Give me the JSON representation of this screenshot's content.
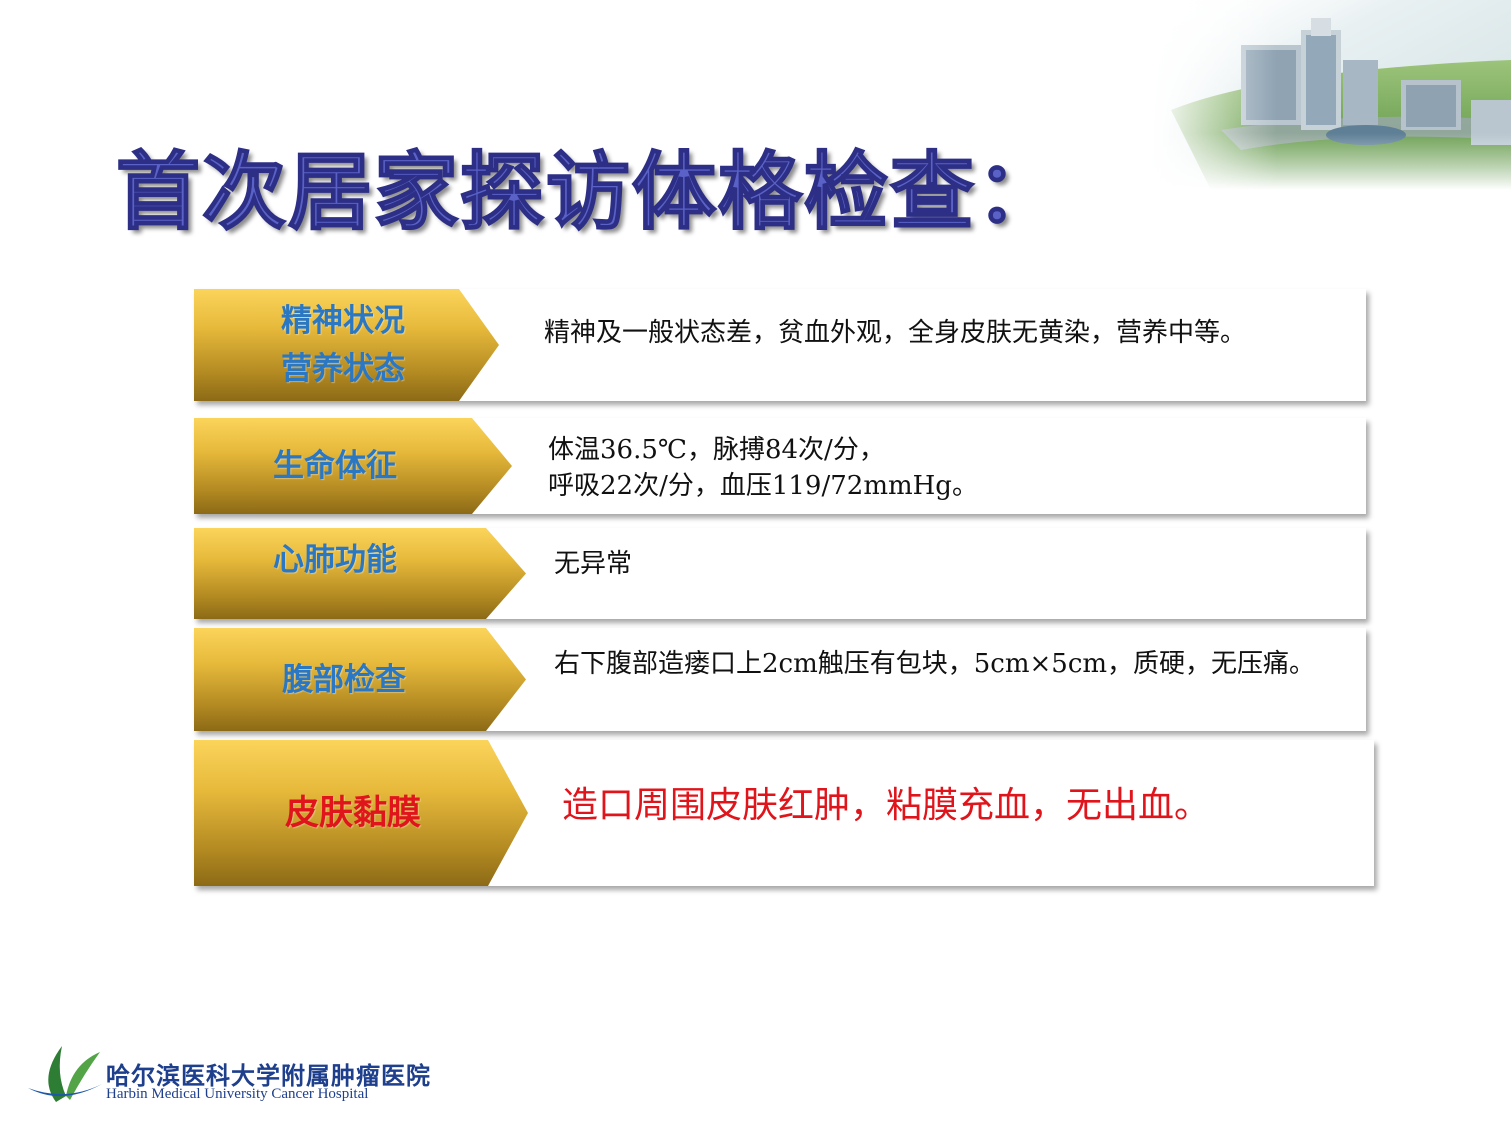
{
  "slide": {
    "title": "首次居家探访体格检查："
  },
  "rows": [
    {
      "label_lines": [
        "精神状况",
        "营养状态"
      ],
      "text_lines": [
        "精神及一般状态差，贫血外观，全身皮肤无黄染，营养中等。"
      ]
    },
    {
      "label_lines": [
        "生命体征"
      ],
      "text_lines": [
        "体温36.5℃，脉搏84次/分，",
        "呼吸22次/分，血压119/72mmHg。"
      ]
    },
    {
      "label_lines": [
        "心肺功能"
      ],
      "text_lines": [
        "无异常"
      ]
    },
    {
      "label_lines": [
        "腹部检查"
      ],
      "text_lines": [
        "右下腹部造瘘口上2cm触压有包块，5cm×5cm，质硬，无压痛。"
      ]
    },
    {
      "label_lines": [
        "皮肤黏膜"
      ],
      "text_lines": [
        "造口周围皮肤红肿，粘膜充血，无出血。"
      ]
    }
  ],
  "footer": {
    "hospital_name_cn": "哈尔滨医科大学附属肿瘤医院",
    "hospital_name_en": "Harbin Medical University Cancer Hospital"
  },
  "colors": {
    "title": "#5a62c8",
    "label": "#2a77c4",
    "highlight": "#e0141b",
    "tab_gold": "#e6b93b"
  },
  "icons": [
    "hospital-buildings-image",
    "hospital-leaf-logo-icon"
  ]
}
